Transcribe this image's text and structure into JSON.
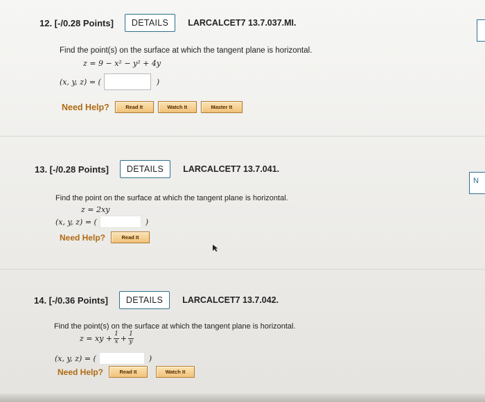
{
  "questions": [
    {
      "number_points": "12. [-/0.28 Points]",
      "details": "DETAILS",
      "code": "LARCALCET7 13.7.037.MI.",
      "prompt": "Find the point(s) on the surface at which the tangent plane is horizontal.",
      "equation": "z = 9 − x² − y² + 4y",
      "answer_label": "(x, y, z) = (",
      "answer_close": ")",
      "answer_value": "",
      "help_label": "Need Help?",
      "help_buttons": [
        "Read It",
        "Watch It",
        "Master It"
      ]
    },
    {
      "number_points": "13. [-/0.28 Points]",
      "details": "DETAILS",
      "code": "LARCALCET7 13.7.041.",
      "prompt": "Find the point on the surface at which the tangent plane is horizontal.",
      "equation": "z = 2xy",
      "answer_label": "(x, y, z) = (",
      "answer_close": ")",
      "answer_value": "",
      "help_label": "Need Help?",
      "help_buttons": [
        "Read It"
      ]
    },
    {
      "number_points": "14. [-/0.36 Points]",
      "details": "DETAILS",
      "code": "LARCALCET7 13.7.042.",
      "prompt": "Find the point(s) on the surface at which the tangent plane is horizontal.",
      "equation_prefix": "z = xy +",
      "frac1": {
        "num": "1",
        "den": "x"
      },
      "plus": "+",
      "frac2": {
        "num": "1",
        "den": "y"
      },
      "answer_label": "(x, y, z) = (",
      "answer_close": ")",
      "answer_value": "",
      "help_label": "Need Help?",
      "help_buttons": [
        "Read It",
        "Watch It"
      ]
    }
  ],
  "edge": {
    "right_box_2_label": "N"
  }
}
